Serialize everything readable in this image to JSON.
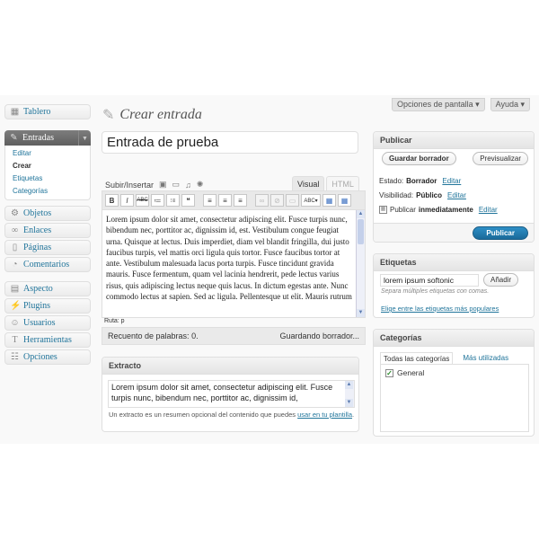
{
  "header": {
    "screen_options": "Opciones de pantalla ▾",
    "help": "Ayuda ▾",
    "page_title": "Crear entrada"
  },
  "sidebar": {
    "dashboard": "Tablero",
    "posts": {
      "label": "Entradas",
      "submenu": [
        "Editar",
        "Crear",
        "Etiquetas",
        "Categorías"
      ],
      "current": "Crear"
    },
    "items_group1": [
      "Objetos",
      "Enlaces",
      "Páginas",
      "Comentarios"
    ],
    "items_group2": [
      "Aspecto",
      "Plugins",
      "Usuarios",
      "Herramientas",
      "Opciones"
    ]
  },
  "editor": {
    "title_value": "Entrada de prueba",
    "upload_label": "Subir/Insertar",
    "tab_visual": "Visual",
    "tab_html": "HTML",
    "toolbar": [
      "B",
      "I",
      "ABC",
      "≔",
      "⁝≡",
      "❝",
      "≡",
      "≡",
      "≡",
      "∞",
      "⊘",
      "▭",
      "ABC▾",
      "▦",
      "▦"
    ],
    "body_text": "Lorem ipsum dolor sit amet, consectetur adipiscing elit. Fusce turpis nunc, bibendum nec, porttitor ac, dignissim id, est. Vestibulum congue feugiat urna. Quisque at lectus. Duis imperdiet, diam vel blandit fringilla, dui justo faucibus turpis, vel mattis orci ligula quis tortor. Fusce faucibus tortor at ante. Vestibulum malesuada lacus porta turpis. Fusce tincidunt gravida mauris. Fusce fermentum, quam vel lacinia hendrerit, pede lectus varius risus, quis adipiscing lectus neque quis lacus. In dictum egestas ante. Nunc commodo lectus at sapien. Sed ac ligula. Pellentesque ut elit. Mauris rutrum",
    "path": "Ruta: p",
    "word_count": "Recuento de palabras: 0.",
    "saving": "Guardando borrador..."
  },
  "excerpt": {
    "title": "Extracto",
    "text": "Lorem ipsum dolor sit amet, consectetur adipiscing elit. Fusce turpis nunc, bibendum nec, porttitor ac, dignissim id,",
    "help_prefix": "Un extracto es un resumen opcional del contenido que puedes ",
    "help_link": "usar en tu plantilla",
    "help_suffix": "."
  },
  "publish": {
    "title": "Publicar",
    "save_draft": "Guardar borrador",
    "preview": "Previsualizar",
    "status_label": "Estado:",
    "status_value": "Borrador",
    "visibility_label": "Visibilidad:",
    "visibility_value": "Público",
    "publish_label": "Publicar",
    "publish_value": "inmediatamente",
    "edit": "Editar",
    "publish_button": "Publicar"
  },
  "tags": {
    "title": "Etiquetas",
    "input_value": "lorem ipsum softonic",
    "add_button": "Añadir",
    "hint": "Separa múltiples etiquetas con comas.",
    "popular_link": "Elige entre las etiquetas más populares"
  },
  "categories": {
    "title": "Categorías",
    "tab_all": "Todas las categorías",
    "tab_used": "Más utilizadas",
    "items": [
      {
        "label": "General",
        "checked": true
      }
    ]
  }
}
